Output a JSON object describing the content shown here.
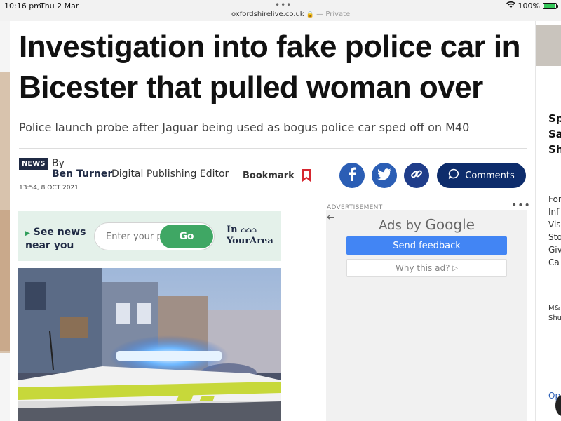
{
  "statusbar": {
    "time": "10:16 pm",
    "date": "Thu 2 Mar",
    "url": "oxfordshirelive.co.uk",
    "private": "— Private",
    "battery": "100%"
  },
  "article": {
    "headline_line1": "Investigation into fake police car in",
    "headline_line2": "Bicester that pulled woman over",
    "subheadline": "Police launch probe after Jaguar being used as bogus police car sped off on M40",
    "badge": "NEWS",
    "by": "By",
    "author": "Ben Turner",
    "role": "Digital Publishing Editor",
    "timestamp": "13:54, 8 OCT 2021",
    "bookmark": "Bookmark",
    "comments": "Comments"
  },
  "near_you": {
    "line1": "See news",
    "line2": "near you",
    "placeholder": "Enter your p",
    "go": "Go",
    "brand_line1": "In",
    "brand_line2": "YourArea"
  },
  "ad": {
    "label": "ADVERTISEMENT",
    "ads_by": "Ads by",
    "google": "Google",
    "send_feedback": "Send feedback",
    "why_ad": "Why this ad?"
  },
  "right_col": {
    "title_lines": [
      "Sp",
      "Sa",
      "Sh"
    ],
    "list_lines": [
      "For",
      "Inf",
      "Vis",
      "Sto",
      "Giv",
      "Ca"
    ],
    "m_lines": [
      "M&",
      "Shu"
    ],
    "op": "Op"
  },
  "colors": {
    "navy": "#1f2a44",
    "green": "#3fa764",
    "google_blue": "#4285f4"
  }
}
